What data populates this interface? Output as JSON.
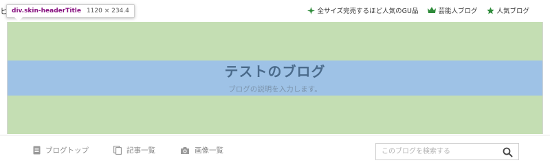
{
  "top_bar": {
    "edge_char": "ヒ",
    "links": [
      {
        "label": "全サイズ完売するほど人気のGU品",
        "icon": "star-plus-icon",
        "color": "#2e8b3a"
      },
      {
        "label": "芸能人ブログ",
        "icon": "crown-icon",
        "color": "#2e8b3a"
      },
      {
        "label": "人気ブログ",
        "icon": "star-icon",
        "color": "#2e8b3a"
      }
    ]
  },
  "devtools_tooltip": {
    "selector": "div.skin-headerTitle",
    "size": "1120 × 234.4"
  },
  "header": {
    "title": "テストのブログ",
    "description": "ブログの説明を入力します。",
    "highlight_colors": {
      "margin": "#c4deb3",
      "content": "#9ec2e6"
    }
  },
  "nav": {
    "items": [
      {
        "label": "ブログトップ",
        "icon": "document-icon"
      },
      {
        "label": "記事一覧",
        "icon": "copy-icon"
      },
      {
        "label": "画像一覧",
        "icon": "camera-icon"
      }
    ],
    "search": {
      "placeholder": "このブログを検索する",
      "value": "",
      "icon": "search-icon"
    }
  }
}
